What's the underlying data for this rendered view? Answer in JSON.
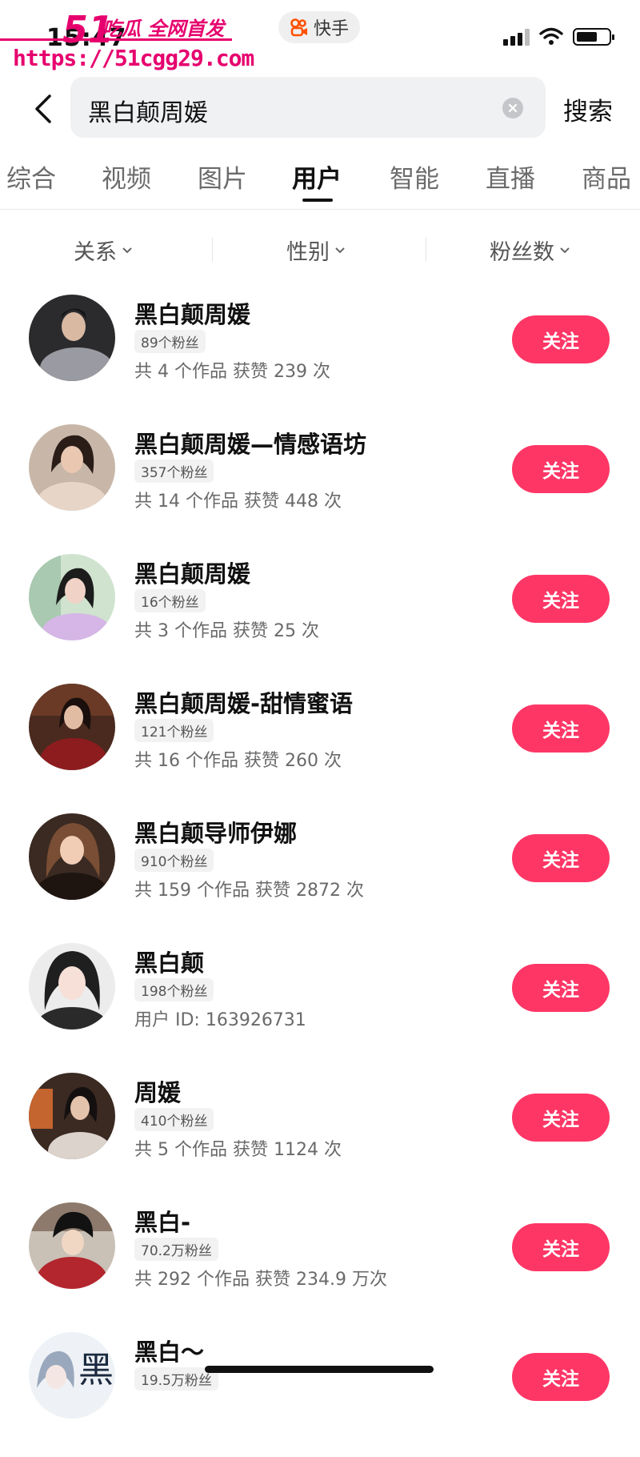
{
  "status": {
    "time": "15:47",
    "app_name": "快手"
  },
  "watermark": {
    "brand": "51",
    "title": "吃瓜 全网首发",
    "url": "https://51cgg29.com"
  },
  "search": {
    "query": "黑白颠周媛",
    "button_label": "搜索"
  },
  "tabs": [
    {
      "label": "综合"
    },
    {
      "label": "视频"
    },
    {
      "label": "图片"
    },
    {
      "label": "用户"
    },
    {
      "label": "智能"
    },
    {
      "label": "直播"
    },
    {
      "label": "商品"
    }
  ],
  "active_tab": "用户",
  "filters": [
    {
      "label": "关系"
    },
    {
      "label": "性别"
    },
    {
      "label": "粉丝数"
    }
  ],
  "results": [
    {
      "name": "黑白颠周媛",
      "fans": "89个粉丝",
      "meta": "共 4 个作品  获赞 239 次",
      "follow_label": "关注"
    },
    {
      "name": "黑白颠周媛—情感语坊",
      "fans": "357个粉丝",
      "meta": "共 14 个作品  获赞 448 次",
      "follow_label": "关注"
    },
    {
      "name": "黑白颠周媛",
      "fans": "16个粉丝",
      "meta": "共 3 个作品  获赞 25 次",
      "follow_label": "关注"
    },
    {
      "name": "黑白颠周媛-甜情蜜语",
      "fans": "121个粉丝",
      "meta": "共 16 个作品  获赞 260 次",
      "follow_label": "关注"
    },
    {
      "name": "黑白颠导师伊娜",
      "fans": "910个粉丝",
      "meta": "共 159 个作品  获赞 2872 次",
      "follow_label": "关注"
    },
    {
      "name": "黑白颠",
      "fans": "198个粉丝",
      "meta": "用户 ID: 163926731",
      "follow_label": "关注"
    },
    {
      "name": "周媛",
      "fans": "410个粉丝",
      "meta": "共 5 个作品  获赞 1124 次",
      "follow_label": "关注"
    },
    {
      "name": "黑白-",
      "fans": "70.2万粉丝",
      "meta": "共 292 个作品  获赞 234.9 万次",
      "follow_label": "关注"
    },
    {
      "name": "黑白～",
      "fans": "19.5万粉丝",
      "meta": "",
      "follow_label": "关注"
    }
  ],
  "colors": {
    "accent": "#fe3666",
    "watermark": "#e6006e",
    "search_bg": "#f0f1f3"
  },
  "icons": [
    "back-chevron-icon",
    "clear-icon",
    "signal-icon",
    "wifi-icon",
    "battery-icon",
    "chevron-down-icon",
    "kuaishou-logo-icon"
  ]
}
